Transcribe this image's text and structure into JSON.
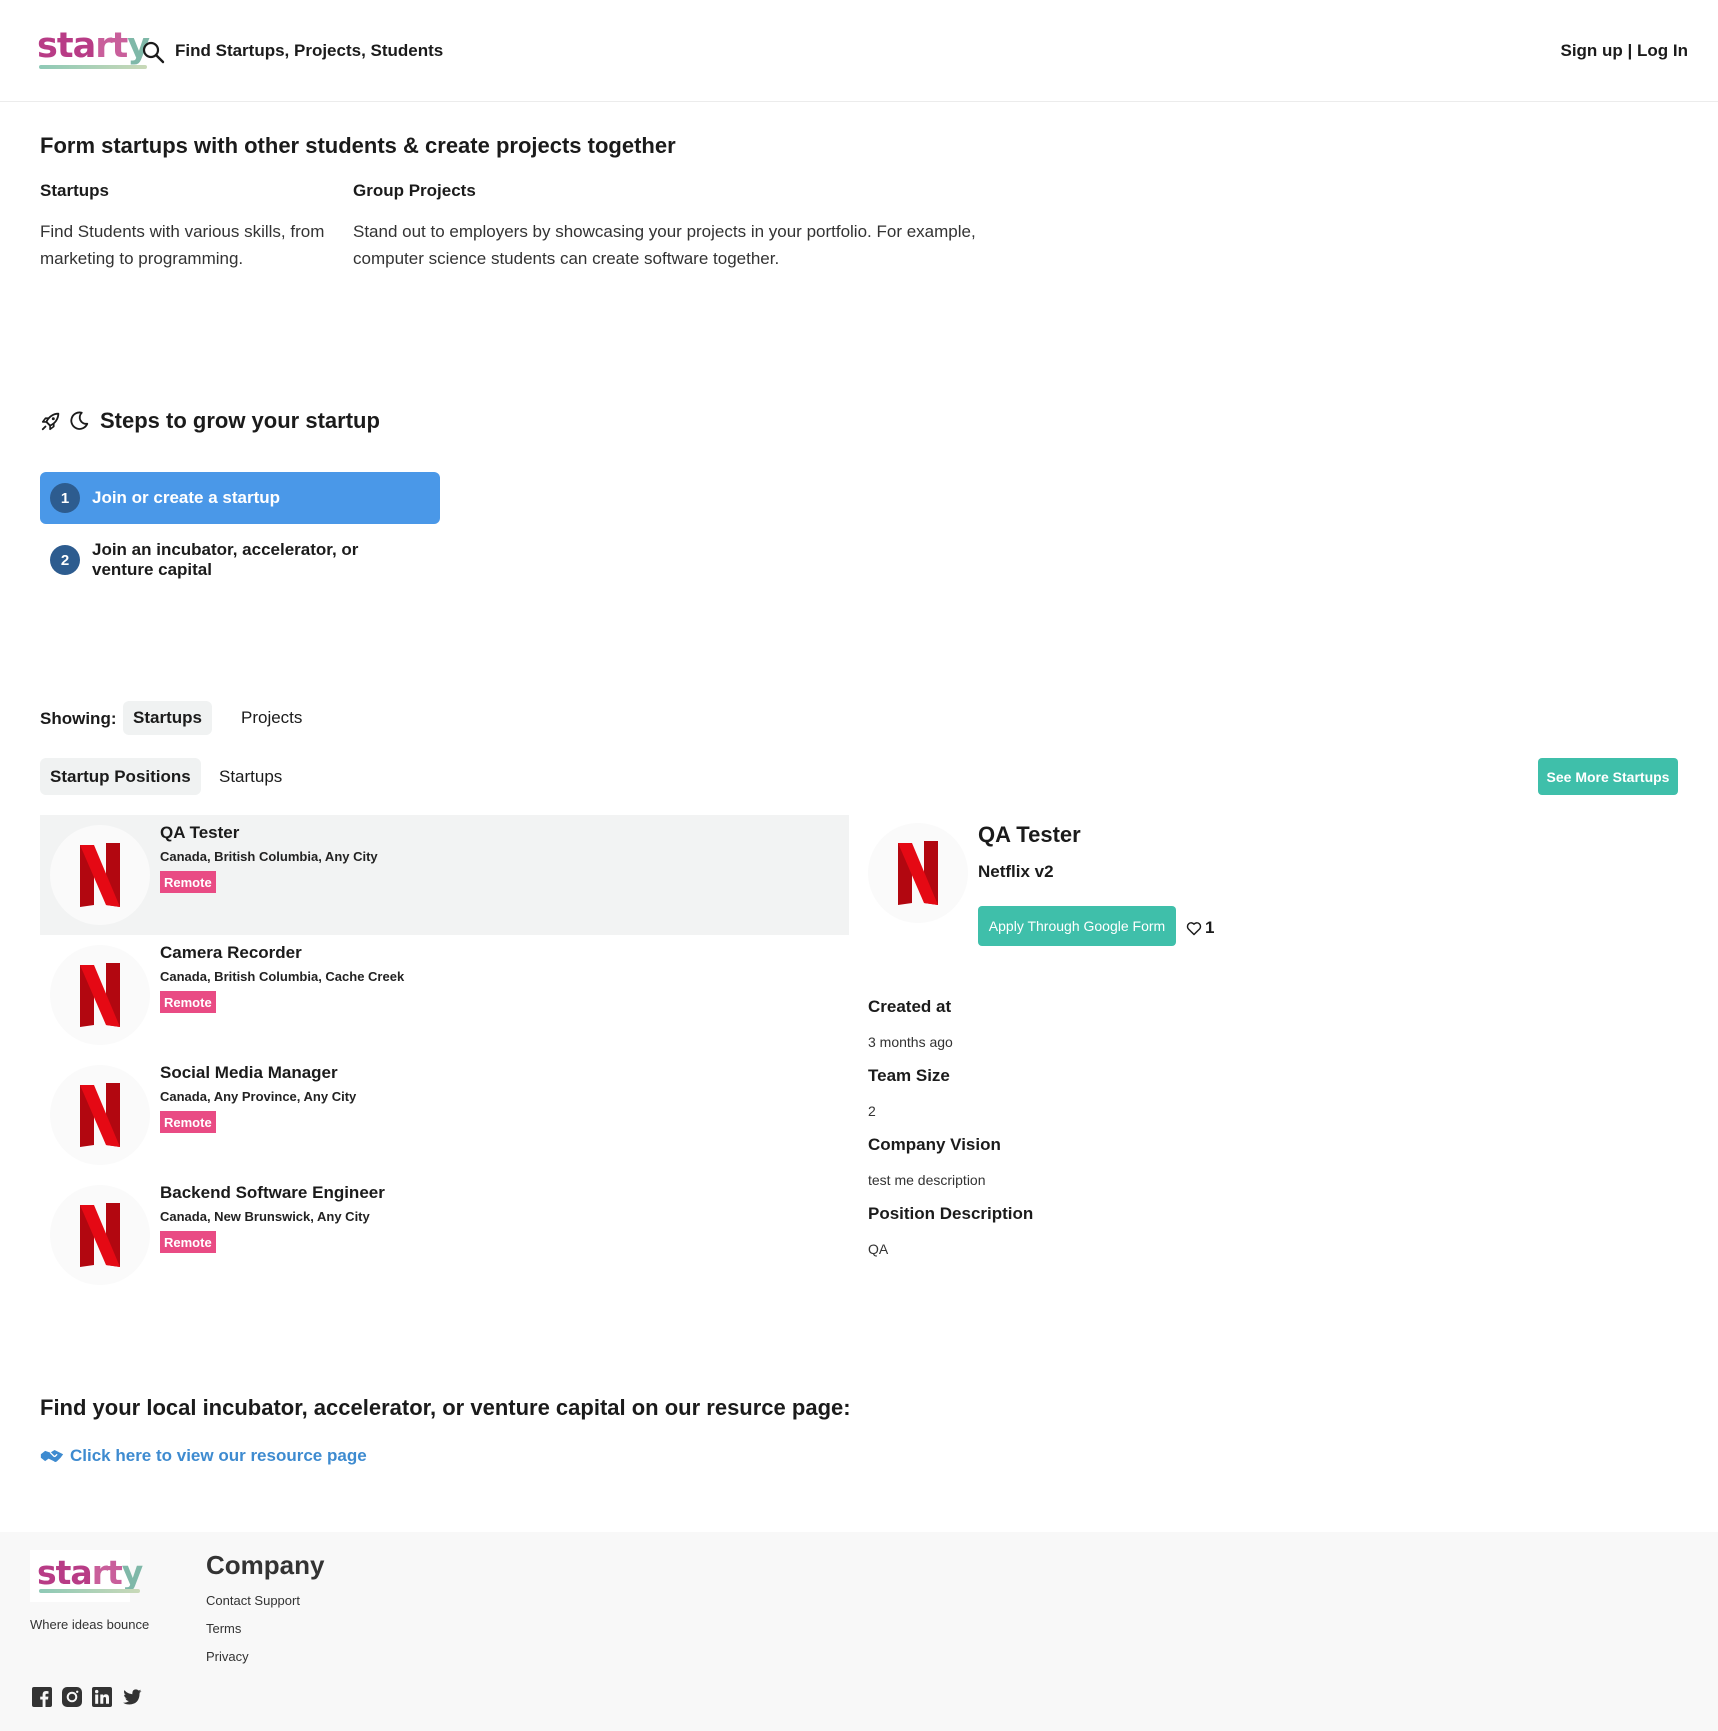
{
  "header": {
    "logo": {
      "part1": "sta",
      "part2": "rt",
      "part3": "y"
    },
    "search_icon": "search-icon",
    "search_placeholder": "Find Startups, Projects, Students",
    "signup": "Sign up",
    "separator": " | ",
    "login": "Log In"
  },
  "hero": {
    "title": "Form startups with other students & create projects together",
    "columns": [
      {
        "title": "Startups",
        "text": "Find Students with various skills, from marketing to programming."
      },
      {
        "title": "Group Projects",
        "text": "Stand out to employers by showcasing your projects in your portfolio. For example, computer science students can create software together."
      }
    ]
  },
  "steps": {
    "icons": [
      "rocket-icon",
      "moon-icon"
    ],
    "title": "Steps to grow your startup",
    "items": [
      {
        "num": "1",
        "label": "Join or create a startup",
        "active": true
      },
      {
        "num": "2",
        "label": "Join an incubator, accelerator, or venture capital",
        "active": false
      }
    ]
  },
  "showing": {
    "label": "Showing:",
    "tabs": [
      "Startups",
      "Projects"
    ],
    "active_tab": "Startups",
    "subtabs": [
      "Startup Positions",
      "Startups"
    ],
    "active_subtab": "Startup Positions",
    "see_more": "See More Startups"
  },
  "positions": [
    {
      "title": "QA Tester",
      "location": "Canada, British Columbia, Any City",
      "badge": "Remote",
      "logo": "netflix-logo",
      "selected": true
    },
    {
      "title": "Camera Recorder",
      "location": "Canada, British Columbia, Cache Creek",
      "badge": "Remote",
      "logo": "netflix-logo",
      "selected": false
    },
    {
      "title": "Social Media Manager",
      "location": "Canada, Any Province, Any City",
      "badge": "Remote",
      "logo": "netflix-logo",
      "selected": false
    },
    {
      "title": "Backend Software Engineer",
      "location": "Canada, New Brunswick, Any City",
      "badge": "Remote",
      "logo": "netflix-logo",
      "selected": false
    }
  ],
  "detail": {
    "title": "QA Tester",
    "company": "Netflix v2",
    "apply": "Apply Through Google Form",
    "likes": "1",
    "fields": [
      {
        "label": "Created at",
        "value": "3 months ago"
      },
      {
        "label": "Team Size",
        "value": "2"
      },
      {
        "label": "Company Vision",
        "value": "test me description"
      },
      {
        "label": "Position Description",
        "value": "QA"
      }
    ]
  },
  "resource": {
    "title": "Find your local incubator, accelerator, or venture capital on our resurce page:",
    "link": "Click here to view our resource page",
    "link_icon": "handshake-icon"
  },
  "footer": {
    "tagline": "Where ideas bounce",
    "company_title": "Company",
    "links": [
      "Contact Support",
      "Terms",
      "Privacy"
    ],
    "social": [
      "facebook-icon",
      "instagram-icon",
      "linkedin-icon",
      "twitter-icon"
    ]
  },
  "colors": {
    "accent_teal": "#3fbfaa",
    "step_active": "#4a98e8",
    "badge_pink": "#e94b84",
    "link_blue": "#3e8bd0",
    "logo_magenta": "#b83c86",
    "netflix_red": "#e50914"
  }
}
